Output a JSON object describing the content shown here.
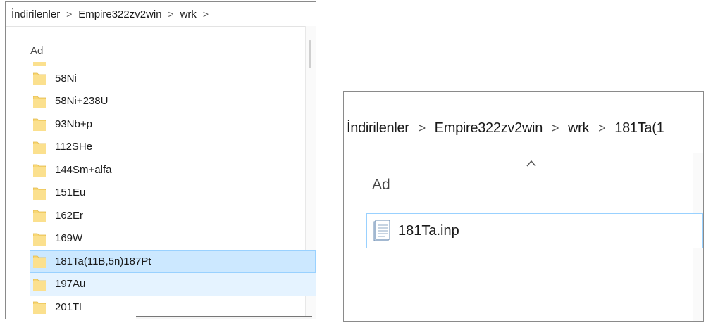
{
  "left_panel": {
    "breadcrumb": [
      "İndirilenler",
      "Empire322zv2win",
      "wrk"
    ],
    "separator": ">",
    "column_header": "Ad",
    "folders": [
      {
        "name": "",
        "state": "partial"
      },
      {
        "name": "58Ni",
        "state": "normal"
      },
      {
        "name": "58Ni+238U",
        "state": "normal"
      },
      {
        "name": "93Nb+p",
        "state": "normal"
      },
      {
        "name": "112SHe",
        "state": "normal"
      },
      {
        "name": "144Sm+alfa",
        "state": "normal"
      },
      {
        "name": "151Eu",
        "state": "normal"
      },
      {
        "name": "162Er",
        "state": "normal"
      },
      {
        "name": "169W",
        "state": "normal"
      },
      {
        "name": "181Ta(11B,5n)187Pt",
        "state": "selected"
      },
      {
        "name": "197Au",
        "state": "hover"
      },
      {
        "name": "201Tl",
        "state": "normal"
      }
    ]
  },
  "right_panel": {
    "breadcrumb": [
      "İndirilenler",
      "Empire322zv2win",
      "wrk",
      "181Ta(1"
    ],
    "separator": ">",
    "column_header": "Ad",
    "sort_icon": "caret-up",
    "files": [
      {
        "name": "181Ta.inp",
        "icon": "text-file-icon"
      }
    ]
  },
  "colors": {
    "folder_yellow": "#f8d775",
    "selected_bg": "#cce8ff",
    "selected_border": "#99d1ff",
    "hover_bg": "#e5f3ff"
  }
}
